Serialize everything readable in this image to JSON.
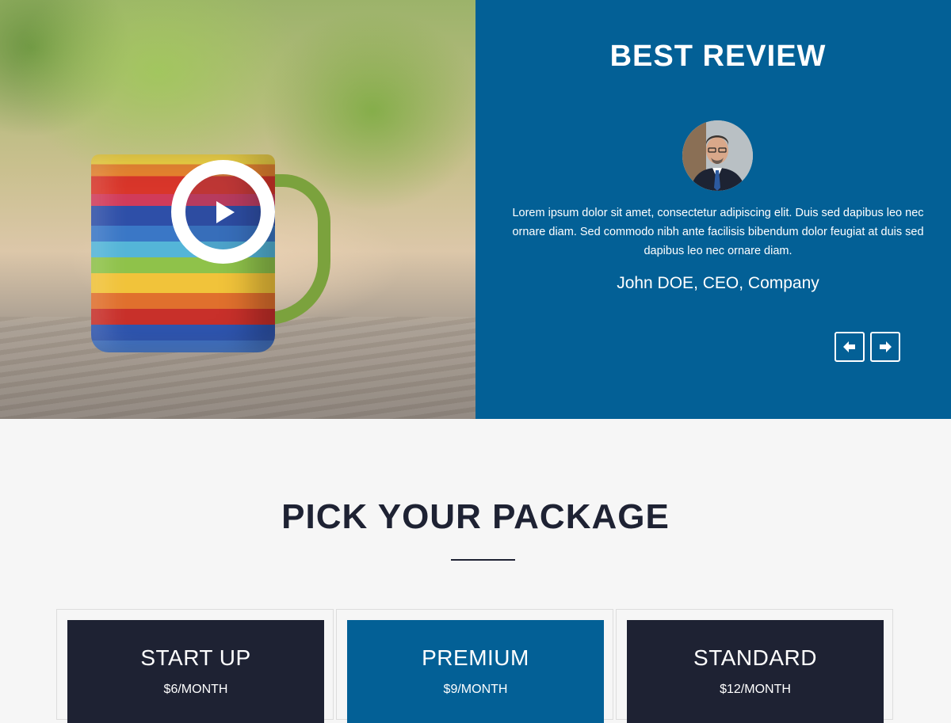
{
  "review": {
    "title": "BEST REVIEW",
    "text": "Lorem ipsum dolor sit amet, consectetur adipiscing elit. Duis sed dapibus leo nec ornare diam. Sed commodo nibh ante facilisis bibendum dolor feugiat at duis sed dapibus leo nec ornare diam.",
    "author": "John DOE, CEO, Company",
    "prev_icon": "arrow-left-icon",
    "next_icon": "arrow-right-icon"
  },
  "video": {
    "play_icon": "play-icon"
  },
  "packages": {
    "title": "PICK YOUR PACKAGE",
    "items": [
      {
        "name": "START UP",
        "price": "$6/MONTH"
      },
      {
        "name": "PREMIUM",
        "price": "$9/MONTH"
      },
      {
        "name": "STANDARD",
        "price": "$12/MONTH"
      }
    ]
  },
  "colors": {
    "brand_blue": "#036096",
    "dark_navy": "#1e2233",
    "background": "#f6f6f6"
  }
}
